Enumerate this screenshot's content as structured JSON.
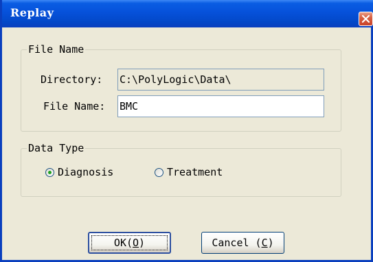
{
  "window": {
    "title": "Replay",
    "close_icon": "close-icon"
  },
  "file_name_group": {
    "legend": "File Name",
    "directory_label": "Directory:",
    "directory_value": "C:\\PolyLogic\\Data\\",
    "file_name_label": "File Name:",
    "file_name_value": "BMC"
  },
  "data_type_group": {
    "legend": "Data Type",
    "options": [
      {
        "label": "Diagnosis",
        "checked": true
      },
      {
        "label": "Treatment",
        "checked": false
      }
    ]
  },
  "buttons": {
    "ok": {
      "text": "OK(",
      "mnemonic": "O",
      "close": ")"
    },
    "cancel": {
      "text": "Cancel (",
      "mnemonic": "C",
      "close": ")"
    }
  },
  "colors": {
    "titlebar": "#0651da",
    "window_bg": "#ece9d8",
    "close_button": "#d86042",
    "radio_dot": "#21a121"
  }
}
